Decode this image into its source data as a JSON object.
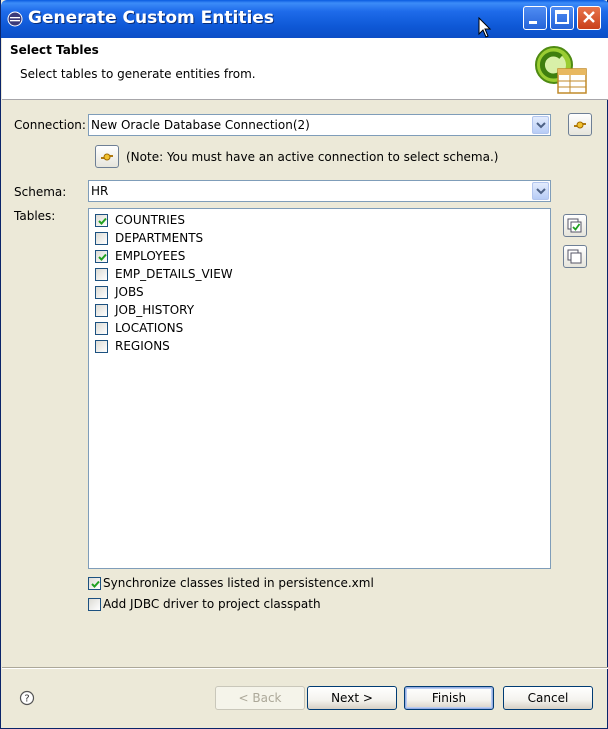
{
  "window": {
    "title": "Generate Custom Entities"
  },
  "header": {
    "title": "Select Tables",
    "description": "Select tables to generate entities from."
  },
  "connection": {
    "label": "Connection:",
    "value": "New Oracle Database Connection(2)",
    "note": "(Note: You must have an active connection to select schema.)"
  },
  "schema": {
    "label": "Schema:",
    "value": "HR"
  },
  "tables": {
    "label": "Tables:",
    "items": [
      {
        "name": "COUNTRIES",
        "checked": true
      },
      {
        "name": "DEPARTMENTS",
        "checked": false
      },
      {
        "name": "EMPLOYEES",
        "checked": true
      },
      {
        "name": "EMP_DETAILS_VIEW",
        "checked": false
      },
      {
        "name": "JOBS",
        "checked": false
      },
      {
        "name": "JOB_HISTORY",
        "checked": false
      },
      {
        "name": "LOCATIONS",
        "checked": false
      },
      {
        "name": "REGIONS",
        "checked": false
      }
    ]
  },
  "options": {
    "sync": {
      "label": "Synchronize classes listed in persistence.xml",
      "checked": true
    },
    "jdbc": {
      "label": "Add JDBC driver to project classpath",
      "checked": false
    }
  },
  "buttons": {
    "back": "< Back",
    "next": "Next >",
    "finish": "Finish",
    "cancel": "Cancel"
  },
  "colors": {
    "titlebar": "#0E58D6",
    "dialog_bg": "#ECE9D8",
    "check": "#21A121"
  }
}
